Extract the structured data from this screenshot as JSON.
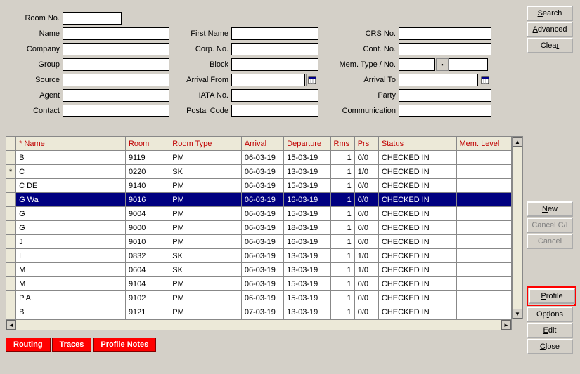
{
  "filters": {
    "room_no_label": "Room No.",
    "name_label": "Name",
    "company_label": "Company",
    "group_label": "Group",
    "source_label": "Source",
    "agent_label": "Agent",
    "contact_label": "Contact",
    "first_name_label": "First Name",
    "corp_no_label": "Corp. No.",
    "block_label": "Block",
    "arrival_from_label": "Arrival From",
    "iata_no_label": "IATA No.",
    "postal_code_label": "Postal Code",
    "crs_no_label": "CRS No.",
    "conf_no_label": "Conf. No.",
    "mem_type_no_label": "Mem. Type / No.",
    "arrival_to_label": "Arrival To",
    "party_label": "Party",
    "communication_label": "Communication",
    "room_no": "",
    "name": "",
    "company": "",
    "group": "",
    "source": "",
    "agent": "",
    "contact": "",
    "first_name": "",
    "corp_no": "",
    "block": "",
    "arrival_from": "",
    "iata_no": "",
    "postal_code": "",
    "crs_no": "",
    "conf_no": "",
    "mem_type": "",
    "mem_no": "",
    "arrival_to": "",
    "party": "",
    "communication": ""
  },
  "grid": {
    "headers": {
      "name": "Name",
      "room": "Room",
      "room_type": "Room Type",
      "arrival": "Arrival",
      "departure": "Departure",
      "rms": "Rms",
      "prs": "Prs",
      "status": "Status",
      "mem_level": "Mem. Level"
    },
    "star": "*",
    "rows": [
      {
        "mark": "",
        "name": "B",
        "room": "9119",
        "room_type": "PM",
        "arrival": "06-03-19",
        "departure": "15-03-19",
        "rms": "1",
        "prs": "0/0",
        "status": "CHECKED IN",
        "mem": ""
      },
      {
        "mark": "*",
        "name": "C",
        "room": "0220",
        "room_type": "SK",
        "arrival": "06-03-19",
        "departure": "13-03-19",
        "rms": "1",
        "prs": "1/0",
        "status": "CHECKED IN",
        "mem": ""
      },
      {
        "mark": "",
        "name": "C                        DE",
        "room": "9140",
        "room_type": "PM",
        "arrival": "06-03-19",
        "departure": "15-03-19",
        "rms": "1",
        "prs": "0/0",
        "status": "CHECKED IN",
        "mem": ""
      },
      {
        "mark": "",
        "name": "G                        Wa",
        "room": "9016",
        "room_type": "PM",
        "arrival": "06-03-19",
        "departure": "16-03-19",
        "rms": "1",
        "prs": "0/0",
        "status": "CHECKED IN",
        "mem": "",
        "selected": true
      },
      {
        "mark": "",
        "name": "G",
        "room": "9004",
        "room_type": "PM",
        "arrival": "06-03-19",
        "departure": "15-03-19",
        "rms": "1",
        "prs": "0/0",
        "status": "CHECKED IN",
        "mem": ""
      },
      {
        "mark": "",
        "name": "G",
        "room": "9000",
        "room_type": "PM",
        "arrival": "06-03-19",
        "departure": "18-03-19",
        "rms": "1",
        "prs": "0/0",
        "status": "CHECKED IN",
        "mem": ""
      },
      {
        "mark": "",
        "name": "J",
        "room": "9010",
        "room_type": "PM",
        "arrival": "06-03-19",
        "departure": "16-03-19",
        "rms": "1",
        "prs": "0/0",
        "status": "CHECKED IN",
        "mem": ""
      },
      {
        "mark": "",
        "name": "L",
        "room": "0832",
        "room_type": "SK",
        "arrival": "06-03-19",
        "departure": "13-03-19",
        "rms": "1",
        "prs": "1/0",
        "status": "CHECKED IN",
        "mem": ""
      },
      {
        "mark": "",
        "name": "M",
        "room": "0604",
        "room_type": "SK",
        "arrival": "06-03-19",
        "departure": "13-03-19",
        "rms": "1",
        "prs": "1/0",
        "status": "CHECKED IN",
        "mem": ""
      },
      {
        "mark": "",
        "name": "M",
        "room": "9104",
        "room_type": "PM",
        "arrival": "06-03-19",
        "departure": "15-03-19",
        "rms": "1",
        "prs": "0/0",
        "status": "CHECKED IN",
        "mem": ""
      },
      {
        "mark": "",
        "name": "P                        A.",
        "room": "9102",
        "room_type": "PM",
        "arrival": "06-03-19",
        "departure": "15-03-19",
        "rms": "1",
        "prs": "0/0",
        "status": "CHECKED IN",
        "mem": ""
      },
      {
        "mark": "",
        "name": "B",
        "room": "9121",
        "room_type": "PM",
        "arrival": "07-03-19",
        "departure": "13-03-19",
        "rms": "1",
        "prs": "0/0",
        "status": "CHECKED IN",
        "mem": ""
      }
    ]
  },
  "footer": {
    "routing": "Routing",
    "traces": "Traces",
    "profile_notes": "Profile Notes"
  },
  "side": {
    "search": "Search",
    "advanced": "Advanced",
    "clear": "Clear",
    "new_btn": "New",
    "cancel_ci": "Cancel C/I",
    "cancel": "Cancel",
    "profile": "Profile",
    "options": "Options",
    "edit": "Edit",
    "close": "Close"
  }
}
